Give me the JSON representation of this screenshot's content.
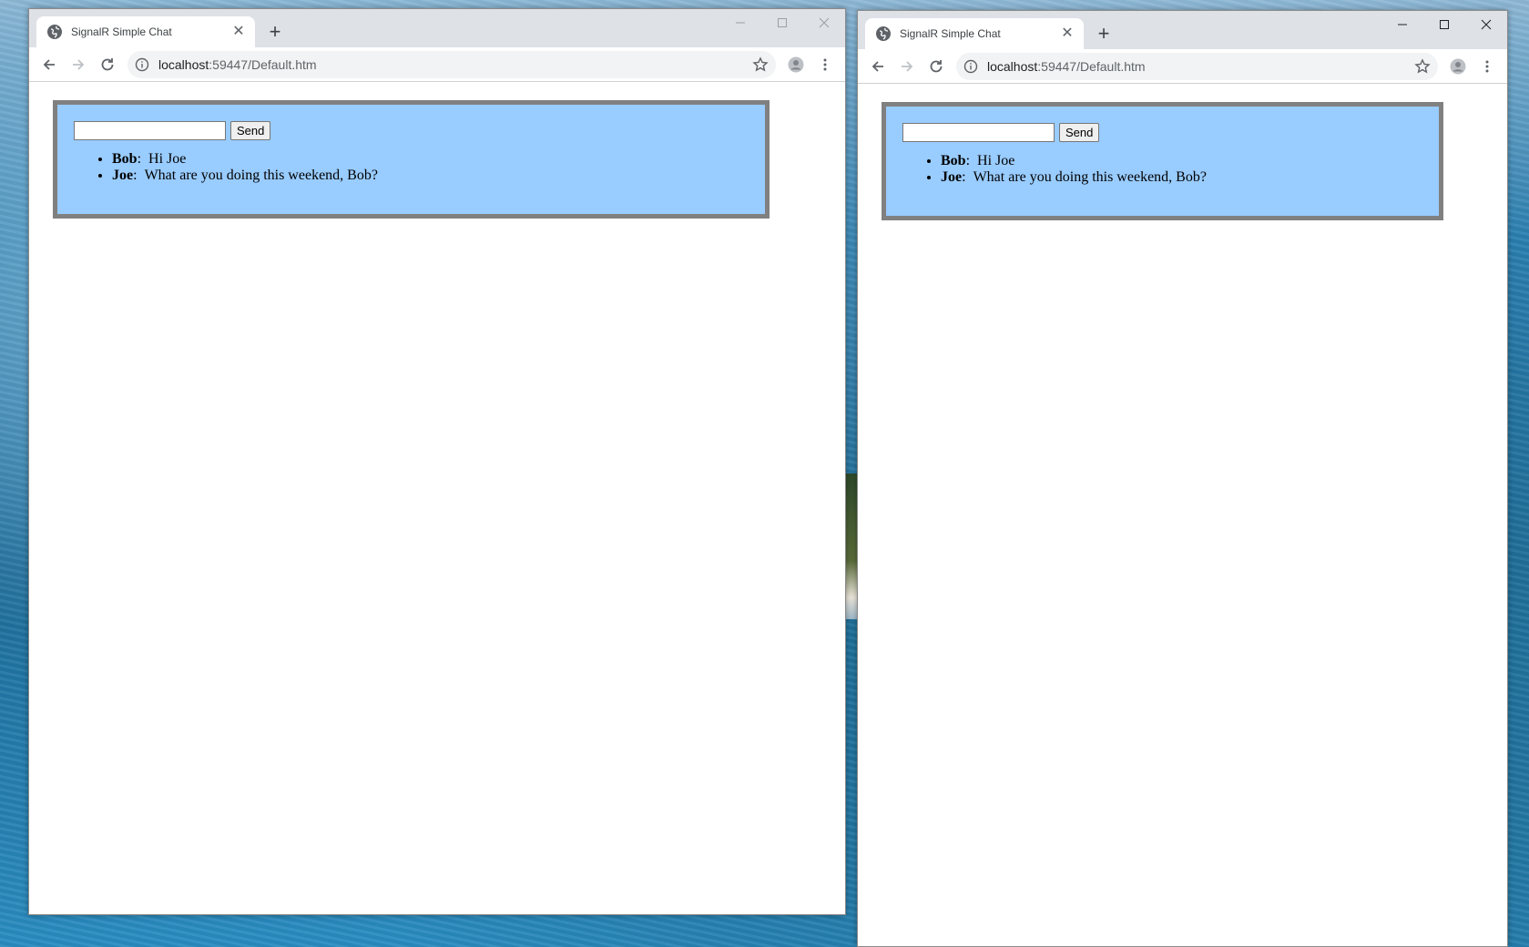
{
  "windows": [
    {
      "tab_title": "SignalR Simple Chat",
      "url_host": "localhost",
      "url_path": ":59447/Default.htm",
      "send_label": "Send",
      "input_value": "",
      "messages": [
        {
          "name": "Bob",
          "sep": ":",
          "text": "Hi Joe"
        },
        {
          "name": "Joe",
          "sep": ":",
          "text": "What are you doing this weekend, Bob?"
        }
      ]
    },
    {
      "tab_title": "SignalR Simple Chat",
      "url_host": "localhost",
      "url_path": ":59447/Default.htm",
      "send_label": "Send",
      "input_value": "",
      "messages": [
        {
          "name": "Bob",
          "sep": ":",
          "text": "Hi Joe"
        },
        {
          "name": "Joe",
          "sep": ":",
          "text": "What are you doing this weekend, Bob?"
        }
      ]
    }
  ],
  "icons": {
    "favicon": "globe-icon",
    "tab_close": "close-icon",
    "new_tab": "plus-icon",
    "back": "back-arrow-icon",
    "forward": "forward-arrow-icon",
    "reload": "reload-icon",
    "site_info": "info-icon",
    "bookmark": "star-icon",
    "profile": "profile-avatar-icon",
    "menu": "more-vertical-icon"
  },
  "colors": {
    "chat_background": "#99ccff",
    "chat_border": "#808080"
  }
}
